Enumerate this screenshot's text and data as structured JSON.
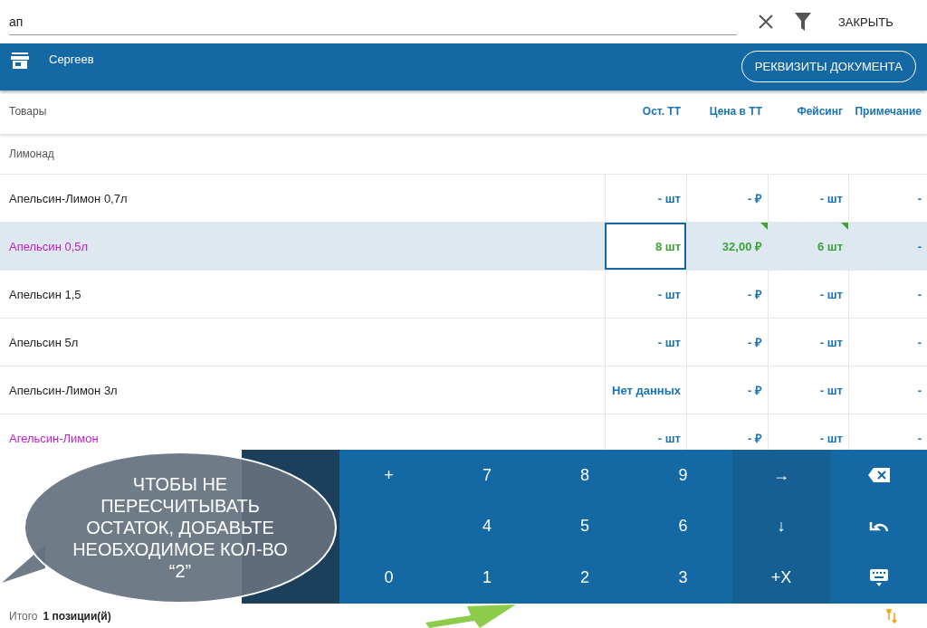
{
  "search": {
    "value": "ап",
    "close_label": "ЗАКРЫТЬ"
  },
  "header": {
    "store": "Сергеев",
    "details_button": "РЕКВИЗИТЫ ДОКУМЕНТА"
  },
  "table": {
    "columns": [
      "Товары",
      "Ост. ТТ",
      "Цена в ТТ",
      "Фейсинг",
      "Примечание"
    ],
    "group": "Лимонад",
    "rows": [
      {
        "selected": false,
        "highlighted": false,
        "cells": [
          {
            "text": "Апельсин-Лимон 0,7л",
            "entered": false,
            "flagged": false,
            "focused": false
          },
          {
            "text": "- шт",
            "entered": false,
            "flagged": false,
            "focused": false
          },
          {
            "text": "- ₽",
            "entered": false,
            "flagged": false,
            "focused": false
          },
          {
            "text": "- шт",
            "entered": false,
            "flagged": false,
            "focused": false
          },
          {
            "text": "-",
            "entered": false,
            "flagged": false,
            "focused": false
          }
        ]
      },
      {
        "selected": true,
        "highlighted": true,
        "cells": [
          {
            "text": "Апельсин 0,5л",
            "entered": false,
            "flagged": false,
            "focused": false
          },
          {
            "text": "8 шт",
            "entered": true,
            "flagged": false,
            "focused": true
          },
          {
            "text": "32,00 ₽",
            "entered": true,
            "flagged": true,
            "focused": false
          },
          {
            "text": "6 шт",
            "entered": true,
            "flagged": true,
            "focused": false
          },
          {
            "text": "-",
            "entered": false,
            "flagged": false,
            "focused": false
          }
        ]
      },
      {
        "selected": false,
        "highlighted": false,
        "cells": [
          {
            "text": "Апельсин 1,5",
            "entered": false,
            "flagged": false,
            "focused": false
          },
          {
            "text": "- шт",
            "entered": false,
            "flagged": false,
            "focused": false
          },
          {
            "text": "- ₽",
            "entered": false,
            "flagged": false,
            "focused": false
          },
          {
            "text": "- шт",
            "entered": false,
            "flagged": false,
            "focused": false
          },
          {
            "text": "-",
            "entered": false,
            "flagged": false,
            "focused": false
          }
        ]
      },
      {
        "selected": false,
        "highlighted": false,
        "cells": [
          {
            "text": "Апельсин 5л",
            "entered": false,
            "flagged": false,
            "focused": false
          },
          {
            "text": "- шт",
            "entered": false,
            "flagged": false,
            "focused": false
          },
          {
            "text": "- ₽",
            "entered": false,
            "flagged": false,
            "focused": false
          },
          {
            "text": "- шт",
            "entered": false,
            "flagged": false,
            "focused": false
          },
          {
            "text": "-",
            "entered": false,
            "flagged": false,
            "focused": false
          }
        ]
      },
      {
        "selected": false,
        "highlighted": false,
        "cells": [
          {
            "text": "Апельсин-Лимон 3л",
            "entered": false,
            "flagged": false,
            "focused": false
          },
          {
            "text": "Нет данных",
            "entered": false,
            "flagged": false,
            "focused": false
          },
          {
            "text": "- ₽",
            "entered": false,
            "flagged": false,
            "focused": false
          },
          {
            "text": "- шт",
            "entered": false,
            "flagged": false,
            "focused": false
          },
          {
            "text": "-",
            "entered": false,
            "flagged": false,
            "focused": false
          }
        ]
      },
      {
        "selected": false,
        "highlighted": true,
        "cells": [
          {
            "text": "Агельсин-Лимон",
            "entered": false,
            "flagged": false,
            "focused": false
          },
          {
            "text": "- шт",
            "entered": false,
            "flagged": false,
            "focused": false
          },
          {
            "text": "- ₽",
            "entered": false,
            "flagged": false,
            "focused": false
          },
          {
            "text": "- шт",
            "entered": false,
            "flagged": false,
            "focused": false
          },
          {
            "text": "-",
            "entered": false,
            "flagged": false,
            "focused": false
          }
        ]
      }
    ]
  },
  "keypad": {
    "columns": [
      {
        "dimmed": false,
        "keys": [
          {
            "kind": "text",
            "label": "+"
          },
          {
            "kind": "blank"
          },
          {
            "kind": "text",
            "label": "0"
          }
        ]
      },
      {
        "dimmed": false,
        "keys": [
          {
            "kind": "text",
            "label": "7"
          },
          {
            "kind": "text",
            "label": "4"
          },
          {
            "kind": "text",
            "label": "1"
          }
        ]
      },
      {
        "dimmed": false,
        "keys": [
          {
            "kind": "text",
            "label": "8"
          },
          {
            "kind": "text",
            "label": "5"
          },
          {
            "kind": "text",
            "label": "2"
          }
        ]
      },
      {
        "dimmed": false,
        "keys": [
          {
            "kind": "text",
            "label": "9"
          },
          {
            "kind": "text",
            "label": "6"
          },
          {
            "kind": "text",
            "label": "3"
          }
        ]
      },
      {
        "dimmed": true,
        "keys": [
          {
            "kind": "text",
            "label": "→"
          },
          {
            "kind": "text",
            "label": "↓"
          },
          {
            "kind": "text",
            "label": "+X"
          }
        ]
      },
      {
        "dimmed": false,
        "keys": [
          {
            "kind": "backspace"
          },
          {
            "kind": "undo"
          },
          {
            "kind": "keyboard"
          }
        ]
      }
    ]
  },
  "footer": {
    "label": "Итого",
    "count": "1 позиции(й)"
  },
  "callout": {
    "text": "ЧТОБЫ НЕ ПЕРЕСЧИТЫВАТЬ ОСТАТОК, ДОБАВЬТЕ НЕОБХОДИМОЕ КОЛ-ВО “2”"
  }
}
